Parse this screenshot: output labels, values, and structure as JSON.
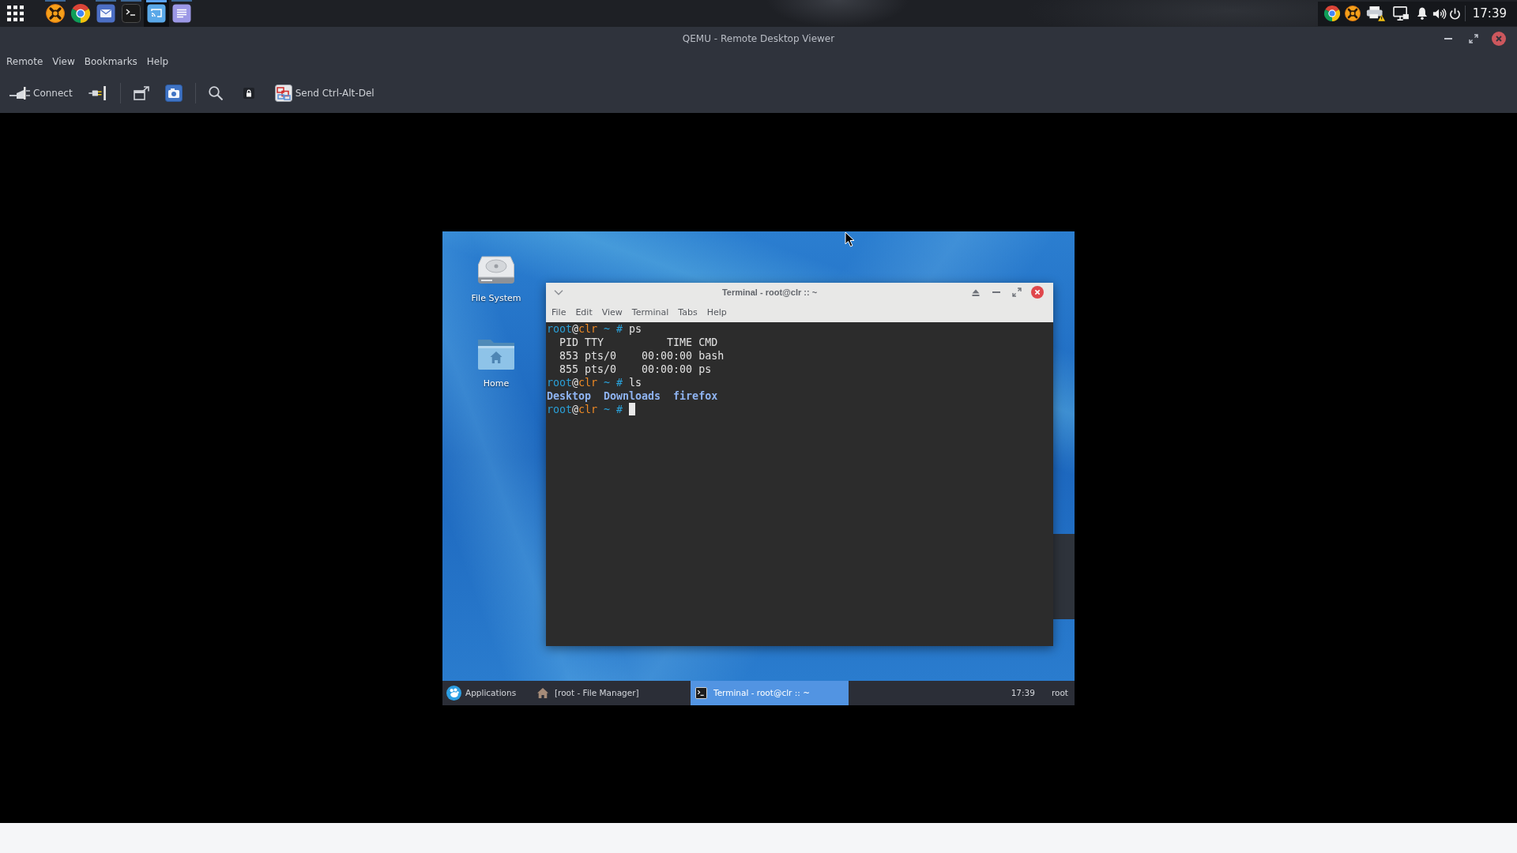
{
  "top_panel": {
    "launchers": [
      {
        "kind": "crossover",
        "running": true,
        "active": false
      },
      {
        "kind": "browser",
        "running": false,
        "active": false
      },
      {
        "kind": "mail",
        "running": true,
        "active": false
      },
      {
        "kind": "terminal",
        "running": true,
        "active": false
      },
      {
        "kind": "remote",
        "running": true,
        "active": true
      },
      {
        "kind": "notes",
        "running": true,
        "active": false
      }
    ],
    "tray": [
      {
        "kind": "browser"
      },
      {
        "kind": "crossover"
      },
      {
        "kind": "printer"
      },
      {
        "kind": "display"
      },
      {
        "kind": "bell"
      },
      {
        "kind": "volume"
      },
      {
        "kind": "power"
      }
    ],
    "clock": "17:39"
  },
  "window": {
    "title": "QEMU - Remote Desktop Viewer",
    "menu": [
      "Remote",
      "View",
      "Bookmarks",
      "Help"
    ],
    "toolbar": [
      {
        "kind": "connect",
        "label": "Connect"
      },
      {
        "kind": "disconnect"
      },
      {
        "kind": "separator"
      },
      {
        "kind": "fullscreen"
      },
      {
        "kind": "screenshot"
      },
      {
        "kind": "separator"
      },
      {
        "kind": "zoom"
      },
      {
        "kind": "lock"
      },
      {
        "kind": "keys",
        "label": "Send Ctrl-Alt-Del"
      }
    ]
  },
  "vm": {
    "desktop_icons": [
      {
        "kind": "drive",
        "label": "File System"
      },
      {
        "kind": "home",
        "label": "Home"
      }
    ],
    "terminal": {
      "title": "Terminal - root@clr :: ~",
      "menu": [
        "File",
        "Edit",
        "View",
        "Terminal",
        "Tabs",
        "Help"
      ],
      "lines": [
        {
          "segments": [
            {
              "kind": "user",
              "text": "root"
            },
            {
              "kind": "at",
              "text": "@"
            },
            {
              "kind": "host",
              "text": "clr"
            },
            {
              "kind": "prompt",
              "text": " ~ # "
            },
            {
              "kind": "plain",
              "text": "ps"
            }
          ],
          "cursor": false
        },
        {
          "segments": [
            {
              "kind": "plain",
              "text": "  PID TTY          TIME CMD"
            }
          ],
          "cursor": false
        },
        {
          "segments": [
            {
              "kind": "plain",
              "text": "  853 pts/0    00:00:00 bash"
            }
          ],
          "cursor": false
        },
        {
          "segments": [
            {
              "kind": "plain",
              "text": "  855 pts/0    00:00:00 ps"
            }
          ],
          "cursor": false
        },
        {
          "segments": [
            {
              "kind": "user",
              "text": "root"
            },
            {
              "kind": "at",
              "text": "@"
            },
            {
              "kind": "host",
              "text": "clr"
            },
            {
              "kind": "prompt",
              "text": " ~ # "
            },
            {
              "kind": "plain",
              "text": "ls"
            }
          ],
          "cursor": false
        },
        {
          "segments": [
            {
              "kind": "dir",
              "text": "Desktop  Downloads  firefox"
            }
          ],
          "cursor": false
        },
        {
          "segments": [
            {
              "kind": "user",
              "text": "root"
            },
            {
              "kind": "at",
              "text": "@"
            },
            {
              "kind": "host",
              "text": "clr"
            },
            {
              "kind": "prompt",
              "text": " ~ # "
            }
          ],
          "cursor": true
        }
      ]
    },
    "taskbar": {
      "menu_button": "Applications",
      "windows": [
        {
          "kind": "files",
          "label": "[root - File Manager]",
          "selected": false
        },
        {
          "kind": "terminal",
          "label": "Terminal - root@clr :: ~",
          "selected": true
        }
      ],
      "clock": "17:39",
      "user": "root"
    }
  }
}
